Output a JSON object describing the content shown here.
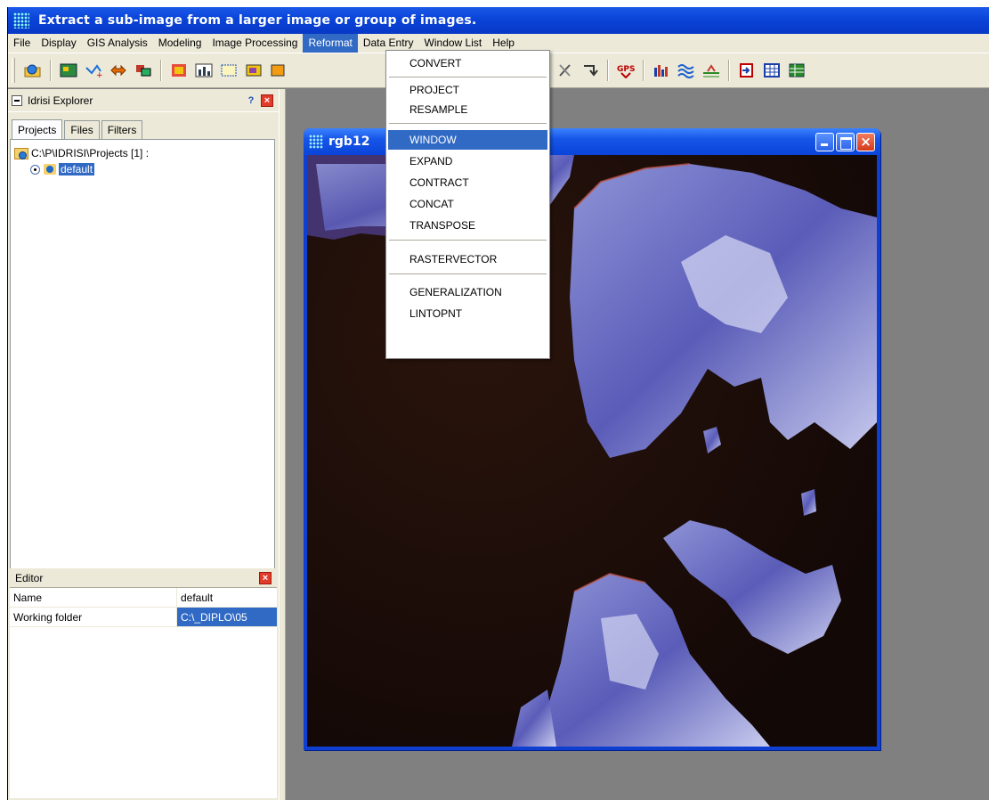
{
  "window": {
    "title": "Extract a sub-image from a larger image or group of images."
  },
  "menubar": [
    "File",
    "Display",
    "GIS Analysis",
    "Modeling",
    "Image Processing",
    "Reformat",
    "Data Entry",
    "Window List",
    "Help"
  ],
  "menubar_active": "Reformat",
  "reformat_menu": {
    "items": [
      "CONVERT",
      "PROJECT",
      "RESAMPLE",
      "WINDOW",
      "EXPAND",
      "CONTRACT",
      "CONCAT",
      "TRANSPOSE",
      "RASTERVECTOR",
      "GENERALIZATION",
      "LINTOPNT"
    ],
    "highlighted": "WINDOW"
  },
  "toolbar": {
    "icons": [
      "project-icon",
      "display-icon",
      "vector-icon",
      "arrows-icon",
      "layers-icon",
      "composite-icon",
      "histogram-icon",
      "window-icon",
      "map-icon",
      "grid-icon",
      "circle-target-icon",
      "crosshair-icon",
      "tools-icon",
      "arrow-down-icon",
      "gps-icon",
      "bar-chart-icon",
      "waves-icon",
      "terrain-icon",
      "import-icon",
      "table-icon",
      "table2-icon"
    ],
    "gps_label": "GPS"
  },
  "explorer": {
    "title": "Idrisi Explorer",
    "help": "?",
    "close": "×",
    "tabs": [
      "Projects",
      "Files",
      "Filters"
    ],
    "active_tab": "Projects",
    "tree": {
      "root": "C:\\P\\IDRISI\\Projects [1] :",
      "child": "default"
    }
  },
  "editor": {
    "title": "Editor",
    "close": "×",
    "rows": [
      {
        "key": "Name",
        "value": "default"
      },
      {
        "key": "Working folder",
        "value": "C:\\_DIPLO\\05"
      }
    ]
  },
  "image_window": {
    "title": "rgb12"
  }
}
